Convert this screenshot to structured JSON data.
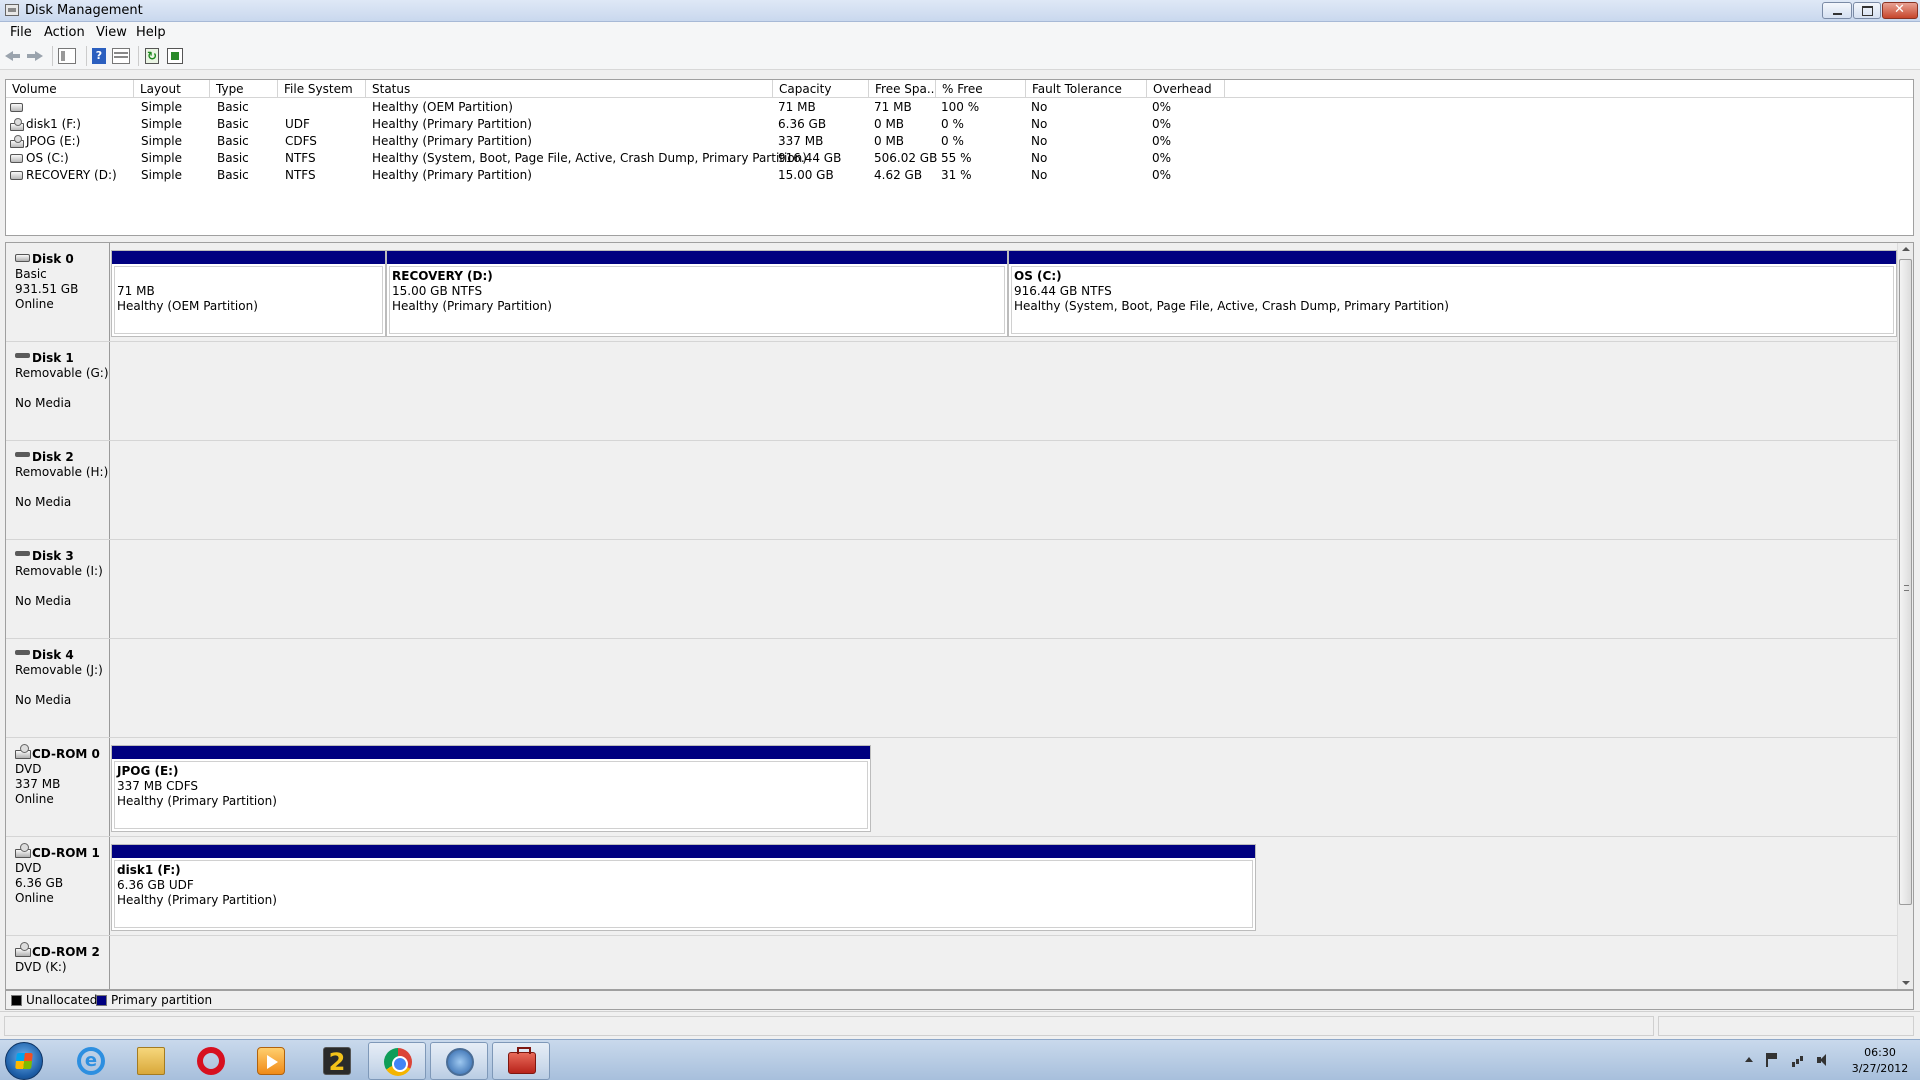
{
  "window": {
    "title": "Disk Management"
  },
  "menu": [
    "File",
    "Action",
    "View",
    "Help"
  ],
  "toolbar": {
    "help_glyph": "?"
  },
  "volume_list": {
    "columns": [
      "Volume",
      "Layout",
      "Type",
      "File System",
      "Status",
      "Capacity",
      "Free Spa...",
      "% Free",
      "Fault Tolerance",
      "Overhead"
    ],
    "rows": [
      {
        "icon": "drive-icon",
        "volume": "",
        "layout": "Simple",
        "type": "Basic",
        "fs": "",
        "status": "Healthy (OEM Partition)",
        "capacity": "71 MB",
        "free": "71 MB",
        "pct": "100 %",
        "fault": "No",
        "overhead": "0%"
      },
      {
        "icon": "cd-drive-icon",
        "volume": "disk1 (F:)",
        "layout": "Simple",
        "type": "Basic",
        "fs": "UDF",
        "status": "Healthy (Primary Partition)",
        "capacity": "6.36 GB",
        "free": "0 MB",
        "pct": "0 %",
        "fault": "No",
        "overhead": "0%"
      },
      {
        "icon": "cd-drive-icon",
        "volume": "JPOG (E:)",
        "layout": "Simple",
        "type": "Basic",
        "fs": "CDFS",
        "status": "Healthy (Primary Partition)",
        "capacity": "337 MB",
        "free": "0 MB",
        "pct": "0 %",
        "fault": "No",
        "overhead": "0%"
      },
      {
        "icon": "drive-icon",
        "volume": "OS (C:)",
        "layout": "Simple",
        "type": "Basic",
        "fs": "NTFS",
        "status": "Healthy (System, Boot, Page File, Active, Crash Dump, Primary Partition)",
        "capacity": "916.44 GB",
        "free": "506.02 GB",
        "pct": "55 %",
        "fault": "No",
        "overhead": "0%"
      },
      {
        "icon": "drive-icon",
        "volume": "RECOVERY (D:)",
        "layout": "Simple",
        "type": "Basic",
        "fs": "NTFS",
        "status": "Healthy (Primary Partition)",
        "capacity": "15.00 GB",
        "free": "4.62 GB",
        "pct": "31 %",
        "fault": "No",
        "overhead": "0%"
      }
    ]
  },
  "disks": [
    {
      "name": "Disk 0",
      "icon": "hard-disk-icon",
      "l1": "Basic",
      "l2": "931.51 GB",
      "l3": "Online",
      "partitions": [
        {
          "name": "",
          "size": "71 MB",
          "status": "Healthy (OEM Partition)"
        },
        {
          "name": "RECOVERY  (D:)",
          "size": "15.00 GB NTFS",
          "status": "Healthy (Primary Partition)"
        },
        {
          "name": "OS  (C:)",
          "size": "916.44 GB NTFS",
          "status": "Healthy (System, Boot, Page File, Active, Crash Dump, Primary Partition)"
        }
      ]
    },
    {
      "name": "Disk 1",
      "icon": "removable-disk-icon",
      "l1": "Removable (G:)",
      "l2": "",
      "l3": "No Media",
      "partitions": []
    },
    {
      "name": "Disk 2",
      "icon": "removable-disk-icon",
      "l1": "Removable (H:)",
      "l2": "",
      "l3": "No Media",
      "partitions": []
    },
    {
      "name": "Disk 3",
      "icon": "removable-disk-icon",
      "l1": "Removable (I:)",
      "l2": "",
      "l3": "No Media",
      "partitions": []
    },
    {
      "name": "Disk 4",
      "icon": "removable-disk-icon",
      "l1": "Removable (J:)",
      "l2": "",
      "l3": "No Media",
      "partitions": []
    },
    {
      "name": "CD-ROM 0",
      "icon": "cd-rom-icon",
      "l1": "DVD",
      "l2": "337 MB",
      "l3": "Online",
      "partitions": [
        {
          "name": "JPOG  (E:)",
          "size": "337 MB CDFS",
          "status": "Healthy (Primary Partition)"
        }
      ]
    },
    {
      "name": "CD-ROM 1",
      "icon": "cd-rom-icon",
      "l1": "DVD",
      "l2": "6.36 GB",
      "l3": "Online",
      "partitions": [
        {
          "name": "disk1  (F:)",
          "size": "6.36 GB UDF",
          "status": "Healthy (Primary Partition)"
        }
      ]
    },
    {
      "name": "CD-ROM 2",
      "icon": "cd-rom-icon",
      "l1": "DVD (K:)",
      "l2": "",
      "l3": "",
      "partitions": []
    }
  ],
  "legend": [
    {
      "label": "Unallocated",
      "color": "#000000"
    },
    {
      "label": "Primary partition",
      "color": "#000080"
    }
  ],
  "taskbar": {
    "apps": [
      "start-button",
      "internet-explorer-icon",
      "windows-explorer-icon",
      "opera-icon",
      "media-player-icon",
      "game-2-icon",
      "chrome-icon",
      "network-app-icon",
      "toolbox-app-icon"
    ],
    "two_glyph": "2",
    "ie_glyph": "e"
  },
  "clock": {
    "time": "06:30",
    "date": "3/27/2012"
  }
}
